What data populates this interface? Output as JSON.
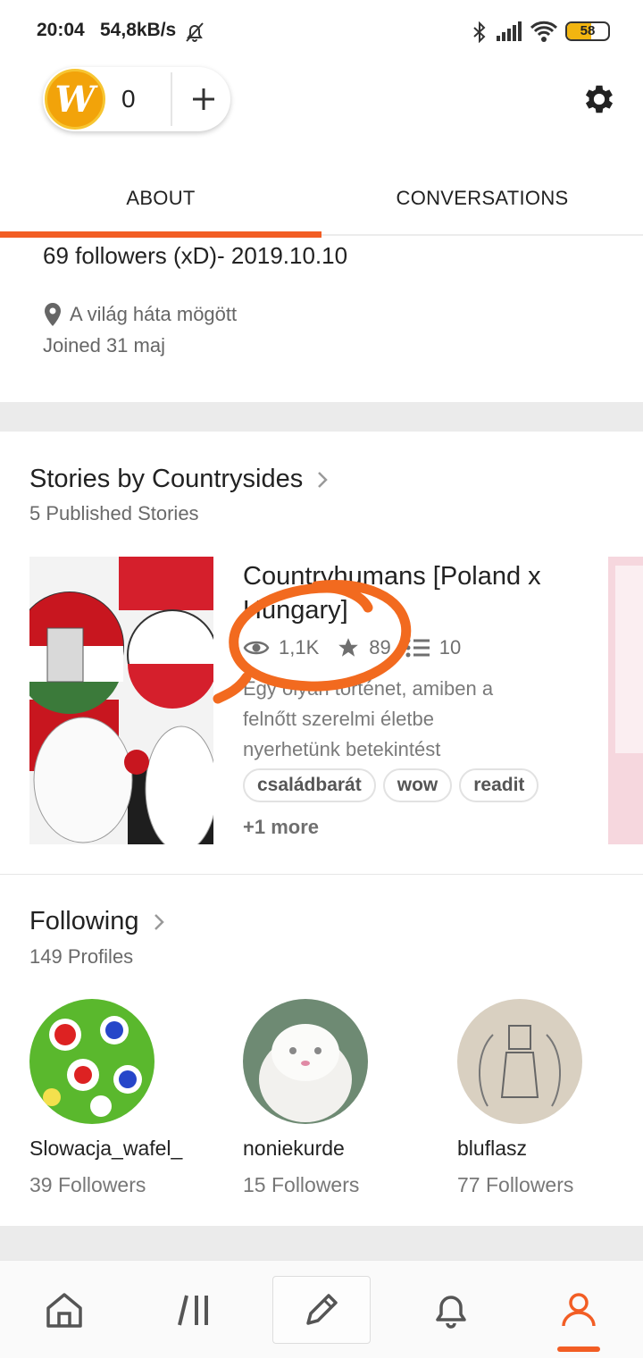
{
  "status_bar": {
    "time": "20:04",
    "net_speed": "54,8kB/s",
    "battery": "58"
  },
  "coins": {
    "coin_letter": "W",
    "count": "0"
  },
  "tabs": [
    {
      "label": "ABOUT",
      "active": true
    },
    {
      "label": "CONVERSATIONS",
      "active": false
    }
  ],
  "about": {
    "description": "69 followers (xD)- 2019.10.10",
    "location": "A világ háta mögött",
    "joined": "Joined 31 maj"
  },
  "stories": {
    "title": "Stories by Countrysides",
    "subtitle": "5 Published Stories",
    "items": [
      {
        "title": "Countryhumans [Poland x Hungary]",
        "reads": "1,1K",
        "votes": "89",
        "parts": "10",
        "description": "Egy olyan történet, amiben a felnőtt szerelmi életbe nyerhetünk betekintést",
        "tags": [
          "családbarát",
          "wow",
          "readit"
        ],
        "more_tags": "+1 more"
      }
    ]
  },
  "following": {
    "title": "Following",
    "subtitle": "149 Profiles",
    "profiles": [
      {
        "name": "Slowacja_wafel_",
        "followers": "39 Followers"
      },
      {
        "name": "noniekurde",
        "followers": "15 Followers"
      },
      {
        "name": "bluflasz",
        "followers": "77 Followers"
      }
    ]
  },
  "bottom_nav": [
    "home-icon",
    "browse-icon",
    "write-icon",
    "notifications-icon",
    "profile-icon"
  ],
  "colors": {
    "accent": "#f25d24",
    "annotation": "#f26a1f"
  }
}
